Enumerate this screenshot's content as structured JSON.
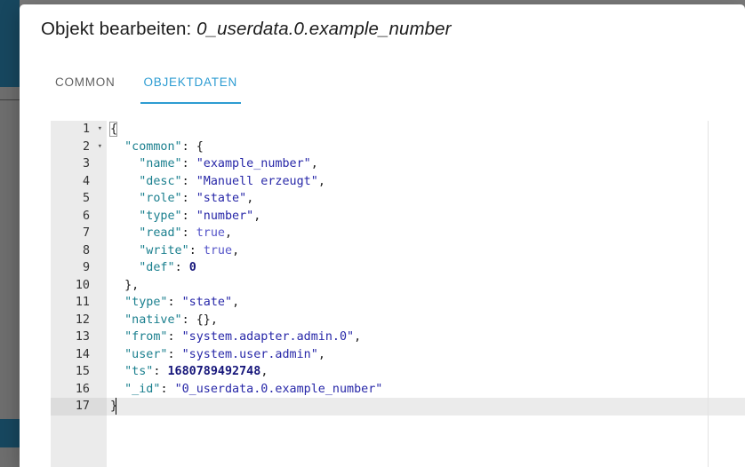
{
  "dialog": {
    "title_prefix": "Objekt bearbeiten: ",
    "object_id": "0_userdata.0.example_number"
  },
  "tabs": [
    {
      "label": "COMMON",
      "active": false
    },
    {
      "label": "OBJEKTDATEN",
      "active": true
    }
  ],
  "editor": {
    "active_line": 17,
    "total_lines": 17,
    "colors": {
      "key": "#1a7f8e",
      "string": "#2727a8",
      "boolean": "#5555c9",
      "number": "#15157a",
      "gutter_bg": "#ebebeb",
      "active_line_bg": "#ebebeb",
      "tab_accent": "#2d9cd2",
      "sidebar": "#17475f"
    },
    "lines": [
      {
        "n": 1,
        "fold": true,
        "indent": 0,
        "tokens": [
          {
            "t": "punct",
            "v": "{"
          }
        ]
      },
      {
        "n": 2,
        "fold": true,
        "indent": 1,
        "tokens": [
          {
            "t": "key",
            "v": "\"common\""
          },
          {
            "t": "punct",
            "v": ": {"
          }
        ]
      },
      {
        "n": 3,
        "fold": false,
        "indent": 2,
        "tokens": [
          {
            "t": "key",
            "v": "\"name\""
          },
          {
            "t": "punct",
            "v": ": "
          },
          {
            "t": "string",
            "v": "\"example_number\""
          },
          {
            "t": "punct",
            "v": ","
          }
        ]
      },
      {
        "n": 4,
        "fold": false,
        "indent": 2,
        "tokens": [
          {
            "t": "key",
            "v": "\"desc\""
          },
          {
            "t": "punct",
            "v": ": "
          },
          {
            "t": "string",
            "v": "\"Manuell erzeugt\""
          },
          {
            "t": "punct",
            "v": ","
          }
        ]
      },
      {
        "n": 5,
        "fold": false,
        "indent": 2,
        "tokens": [
          {
            "t": "key",
            "v": "\"role\""
          },
          {
            "t": "punct",
            "v": ": "
          },
          {
            "t": "string",
            "v": "\"state\""
          },
          {
            "t": "punct",
            "v": ","
          }
        ]
      },
      {
        "n": 6,
        "fold": false,
        "indent": 2,
        "tokens": [
          {
            "t": "key",
            "v": "\"type\""
          },
          {
            "t": "punct",
            "v": ": "
          },
          {
            "t": "string",
            "v": "\"number\""
          },
          {
            "t": "punct",
            "v": ","
          }
        ]
      },
      {
        "n": 7,
        "fold": false,
        "indent": 2,
        "tokens": [
          {
            "t": "key",
            "v": "\"read\""
          },
          {
            "t": "punct",
            "v": ": "
          },
          {
            "t": "bool",
            "v": "true"
          },
          {
            "t": "punct",
            "v": ","
          }
        ]
      },
      {
        "n": 8,
        "fold": false,
        "indent": 2,
        "tokens": [
          {
            "t": "key",
            "v": "\"write\""
          },
          {
            "t": "punct",
            "v": ": "
          },
          {
            "t": "bool",
            "v": "true"
          },
          {
            "t": "punct",
            "v": ","
          }
        ]
      },
      {
        "n": 9,
        "fold": false,
        "indent": 2,
        "tokens": [
          {
            "t": "key",
            "v": "\"def\""
          },
          {
            "t": "punct",
            "v": ": "
          },
          {
            "t": "num",
            "v": "0"
          }
        ]
      },
      {
        "n": 10,
        "fold": false,
        "indent": 1,
        "tokens": [
          {
            "t": "punct",
            "v": "},"
          }
        ]
      },
      {
        "n": 11,
        "fold": false,
        "indent": 1,
        "tokens": [
          {
            "t": "key",
            "v": "\"type\""
          },
          {
            "t": "punct",
            "v": ": "
          },
          {
            "t": "string",
            "v": "\"state\""
          },
          {
            "t": "punct",
            "v": ","
          }
        ]
      },
      {
        "n": 12,
        "fold": false,
        "indent": 1,
        "tokens": [
          {
            "t": "key",
            "v": "\"native\""
          },
          {
            "t": "punct",
            "v": ": {},"
          }
        ]
      },
      {
        "n": 13,
        "fold": false,
        "indent": 1,
        "tokens": [
          {
            "t": "key",
            "v": "\"from\""
          },
          {
            "t": "punct",
            "v": ": "
          },
          {
            "t": "string",
            "v": "\"system.adapter.admin.0\""
          },
          {
            "t": "punct",
            "v": ","
          }
        ]
      },
      {
        "n": 14,
        "fold": false,
        "indent": 1,
        "tokens": [
          {
            "t": "key",
            "v": "\"user\""
          },
          {
            "t": "punct",
            "v": ": "
          },
          {
            "t": "string",
            "v": "\"system.user.admin\""
          },
          {
            "t": "punct",
            "v": ","
          }
        ]
      },
      {
        "n": 15,
        "fold": false,
        "indent": 1,
        "tokens": [
          {
            "t": "key",
            "v": "\"ts\""
          },
          {
            "t": "punct",
            "v": ": "
          },
          {
            "t": "num",
            "v": "1680789492748"
          },
          {
            "t": "punct",
            "v": ","
          }
        ]
      },
      {
        "n": 16,
        "fold": false,
        "indent": 1,
        "tokens": [
          {
            "t": "key",
            "v": "\"_id\""
          },
          {
            "t": "punct",
            "v": ": "
          },
          {
            "t": "string",
            "v": "\"0_userdata.0.example_number\""
          }
        ]
      },
      {
        "n": 17,
        "fold": false,
        "indent": 0,
        "tokens": [
          {
            "t": "punct",
            "v": "}"
          }
        ]
      }
    ]
  }
}
